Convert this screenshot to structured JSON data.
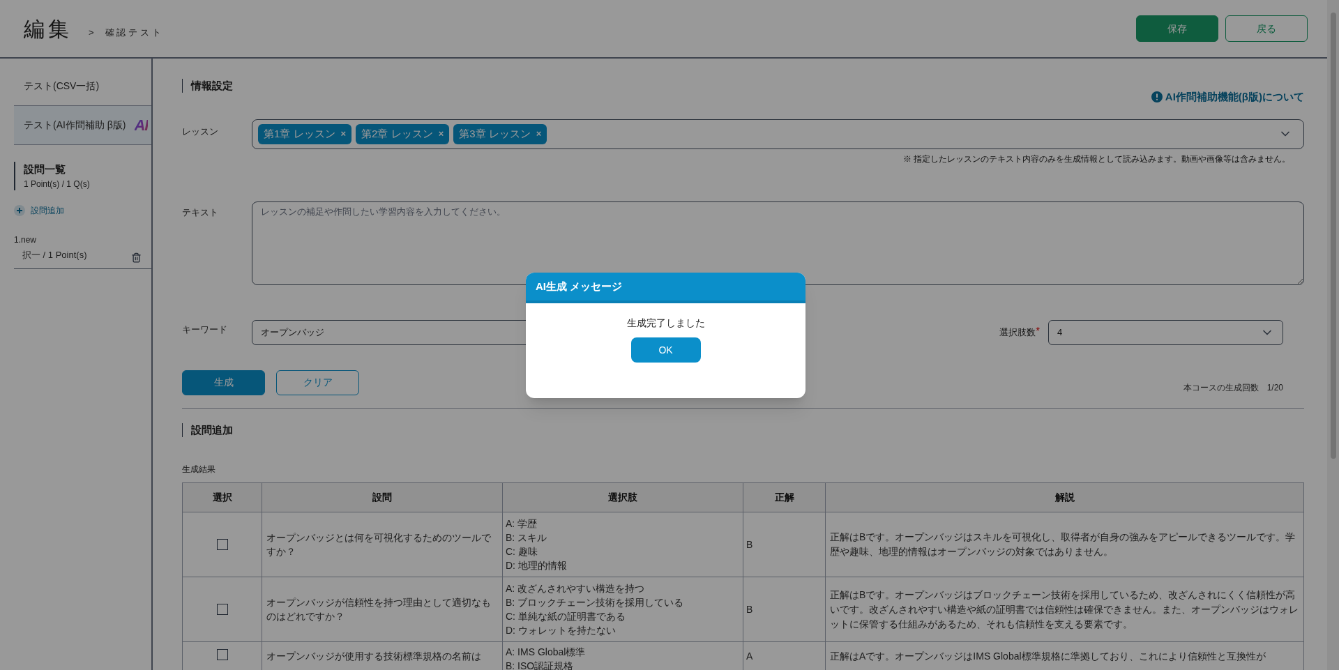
{
  "header": {
    "title": "編集",
    "separator": ">",
    "breadcrumb": "確認テスト",
    "buttons": [
      {
        "label": "保存",
        "kind": "primary"
      },
      {
        "label": "戻る",
        "kind": "outline"
      }
    ]
  },
  "sidebar": {
    "tabs": [
      {
        "label": "テスト(CSV一括)",
        "selected": false
      },
      {
        "label": "テスト(AI作問補助 β版)",
        "selected": true,
        "badge": "AI"
      }
    ],
    "question_list": {
      "title": "設問一覧",
      "summary": "1 Point(s) / 1 Q(s)",
      "add_label": "設問追加",
      "items": [
        {
          "name": "1.new",
          "detail": "択一 / 1 Point(s)"
        }
      ]
    }
  },
  "info_section": {
    "title": "情報設定",
    "help_link": "AI作問補助機能(β版)について",
    "lesson": {
      "label": "レッスン",
      "tags": [
        "第1章 レッスン",
        "第2章 レッスン",
        "第3章 レッスン"
      ],
      "remove_mark": "×",
      "note": "※ 指定したレッスンのテキスト内容のみを生成情報として読み込みます。動画や画像等は含みません。"
    },
    "text": {
      "label": "テキスト",
      "placeholder": "レッスンの補足や作問したい学習内容を入力してください。"
    },
    "keyword": {
      "label": "キーワード",
      "value": "オープンバッジ"
    },
    "choices_count": {
      "label": "選択肢数",
      "required_mark": "*",
      "value": "4"
    },
    "actions": [
      {
        "label": "生成",
        "kind": "primary"
      },
      {
        "label": "クリア",
        "kind": "outline"
      }
    ],
    "usage": {
      "label": "本コースの生成回数",
      "value": "1/20"
    }
  },
  "question_add": {
    "title": "設問追加",
    "results_label": "生成結果",
    "table": {
      "columns": [
        "選択",
        "設問",
        "選択肢",
        "正解",
        "解説"
      ],
      "rows": [
        {
          "checked": false,
          "question": "オープンバッジとは何を可視化するためのツールですか？",
          "choices": [
            "A: 学歴",
            "B: スキル",
            "C: 趣味",
            "D: 地理的情報"
          ],
          "answer": "B",
          "explanation": "正解はBです。オープンバッジはスキルを可視化し、取得者が自身の強みをアピールできるツールです。学歴や趣味、地理的情報はオープンバッジの対象ではありません。"
        },
        {
          "checked": false,
          "question": "オープンバッジが信頼性を持つ理由として適切なものはどれですか？",
          "choices": [
            "A: 改ざんされやすい構造を持つ",
            "B: ブロックチェーン技術を採用している",
            "C: 単純な紙の証明書である",
            "D: ウォレットを持たない"
          ],
          "answer": "B",
          "explanation": "正解はBです。オープンバッジはブロックチェーン技術を採用しているため、改ざんされにくく信頼性が高いです。改ざんされやすい構造や紙の証明書では信頼性は確保できません。また、オープンバッジはウォレットに保管する仕組みがあるため、それも信頼性を支える要素です。"
        },
        {
          "checked": false,
          "question": "オープンバッジが使用する技術標準規格の名前は",
          "choices": [
            "A: IMS Global標準",
            "B: ISO認証規格"
          ],
          "answer": "A",
          "explanation": "正解はAです。オープンバッジはIMS Global標準規格に準拠しており、これにより信頼性と互換性が"
        }
      ]
    }
  },
  "dialog": {
    "title": "AI生成 メッセージ",
    "message": "生成完了しました",
    "button": "OK"
  }
}
